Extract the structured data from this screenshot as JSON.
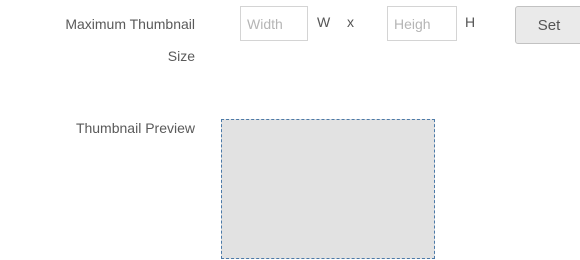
{
  "thumbnail_size": {
    "label_line1": "Maximum Thumbnail",
    "label_line2": "Size",
    "width_placeholder": "Width",
    "width_unit": "W",
    "separator": "x",
    "height_placeholder": "Heigh",
    "height_unit": "H",
    "set_label": "Set"
  },
  "preview": {
    "label": "Thumbnail Preview"
  }
}
